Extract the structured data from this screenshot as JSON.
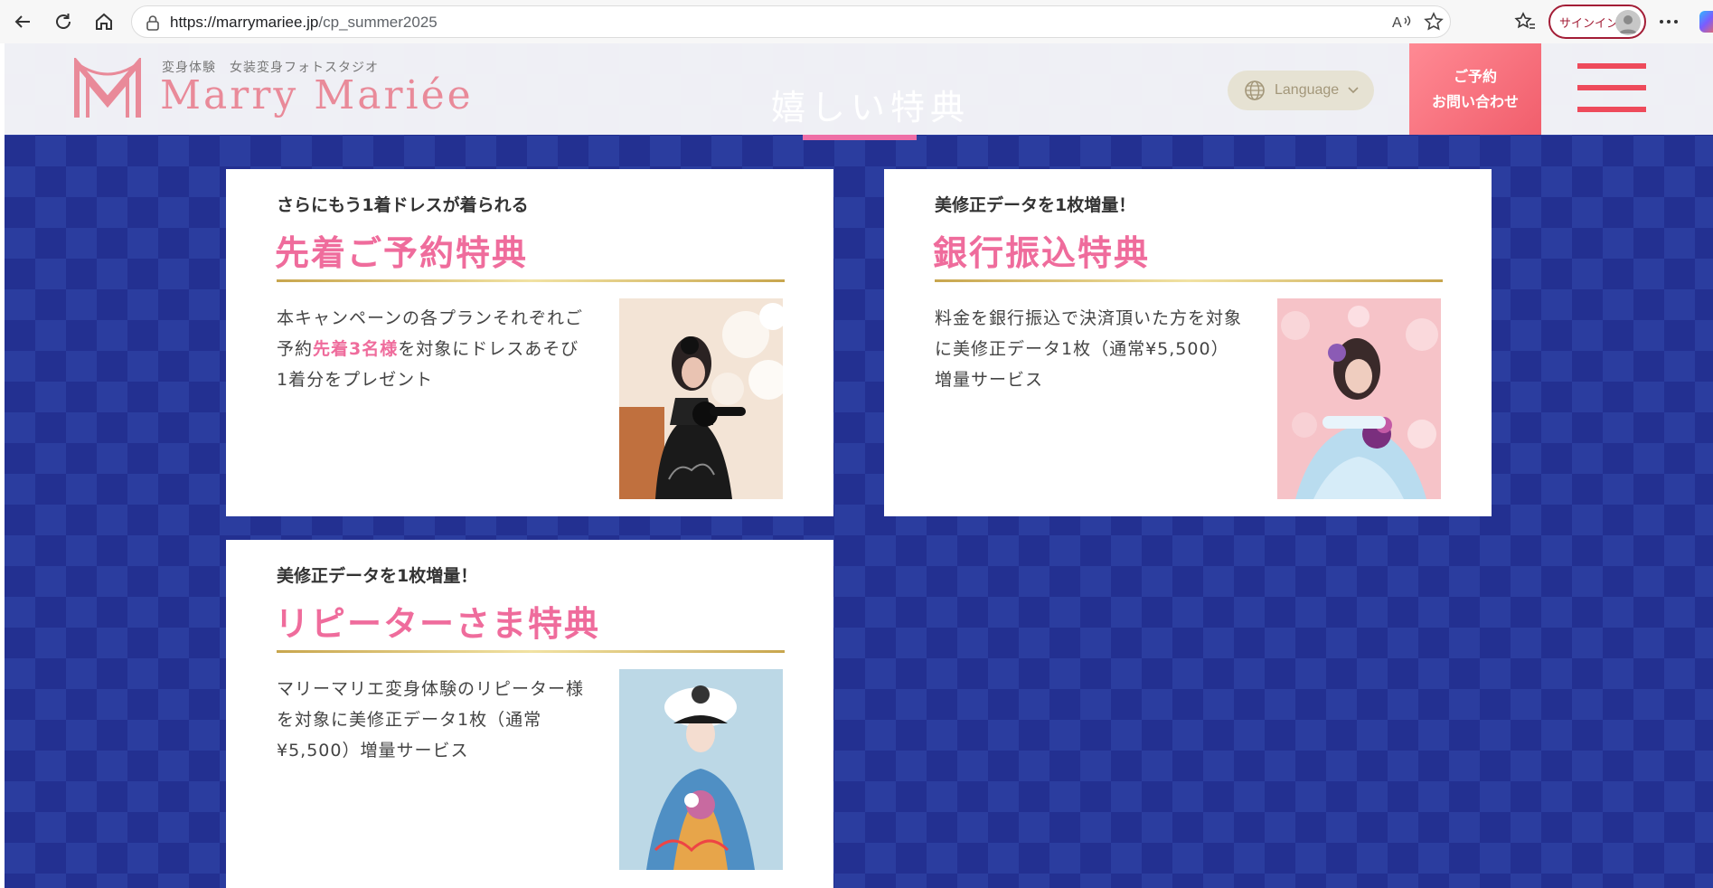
{
  "browser": {
    "url_host": "https://marrymariee.jp",
    "url_path": "/cp_summer2025",
    "signin_label": "サインイン"
  },
  "header": {
    "logo_tagline": "変身体験　女装変身フォトスタジオ",
    "logo_word": "Marry Mariée",
    "section_title": "嬉しい特典",
    "language_label": "Language",
    "reserve_line1": "ご予約",
    "reserve_line2": "お問い合わせ"
  },
  "colors": {
    "accent_pink": "#ef6c9c",
    "navy_bg": "#2b3d9f",
    "gold_rule": "#c8a64e",
    "cta_coral": "#f15e6c"
  },
  "cards": [
    {
      "subtitle": "さらにもう1着ドレスが着られる",
      "title": "先着ご予約特典",
      "body_before": "本キャンペーンの各プランそれぞれご予約",
      "body_highlight": "先着3名様",
      "body_after": "を対象にドレスあそび1着分をプレゼント",
      "photo_icon": "photo-black-dress"
    },
    {
      "subtitle": "美修正データを1枚増量！",
      "title": "銀行振込特典",
      "body_before": "料金を銀行振込で決済頂いた方を対象に美修正データ1枚（通常¥5,500）増量サービス",
      "body_highlight": "",
      "body_after": "",
      "photo_icon": "photo-blue-dress"
    },
    {
      "subtitle": "美修正データを1枚増量！",
      "title": "リピーターさま特典",
      "body_before": "マリーマリエ変身体験のリピーター様を対象に美修正データ1枚（通常¥5,500）増量サービス",
      "body_highlight": "",
      "body_after": "",
      "photo_icon": "photo-kimono"
    }
  ]
}
